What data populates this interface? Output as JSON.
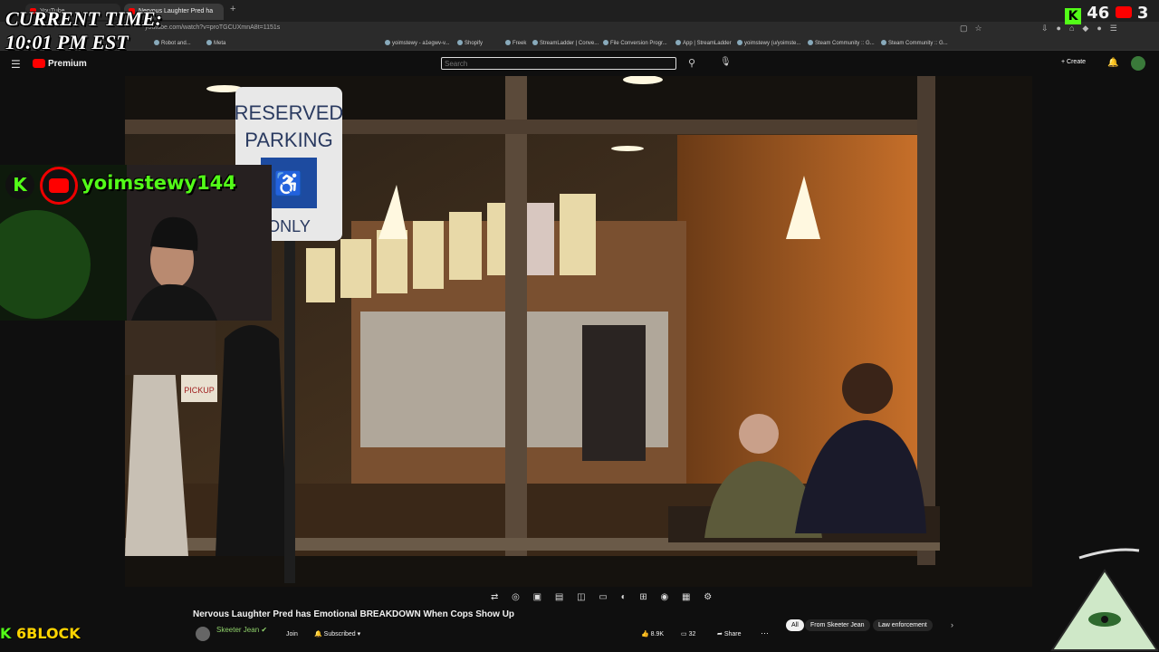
{
  "overlay": {
    "time_label": "CURRENT TIME:",
    "time_value": "10:01 PM EST",
    "streamer": "yoimstewy144",
    "kick_count": "46",
    "yt_count": "3",
    "block_label": "6BLOCK"
  },
  "browser": {
    "tabs": [
      {
        "label": "YouTube"
      },
      {
        "label": "Nervous Laughter Pred ha"
      }
    ],
    "url": "youtube.com/watch?v=proTGCUXmnA8t=1151s",
    "bookmarks": [
      "Robot and...",
      "Meta",
      "yoimstewy - a1egwv-v...",
      "Shopify",
      "Freek",
      "StreamLadder | Conve...",
      "File Conversion Progr...",
      "App | StreamLadder",
      "yoimstewy (u/yoimste...",
      "Steam Community :: G...",
      "Steam Community :: G..."
    ]
  },
  "youtube": {
    "logo": "Premium",
    "search_placeholder": "Search",
    "create": "Create",
    "video_title": "Nervous Laughter Pred has Emotional BREAKDOWN When Cops Show Up",
    "channel": "Skeeter Jean",
    "join": "Join",
    "subscribed": "Subscribed",
    "likes": "8.9K",
    "comments": "32",
    "share": "Share",
    "chips": [
      "All",
      "From Skeeter Jean",
      "Law enforcement"
    ]
  },
  "scene": {
    "sign_line1": "RESERVED",
    "sign_line2": "PARKING",
    "sign_line3": "ONLY",
    "pickup": "PICKUP"
  },
  "colors": {
    "kick": "#53fc18",
    "yt_red": "#ff0000",
    "warm": "#c8702a"
  }
}
